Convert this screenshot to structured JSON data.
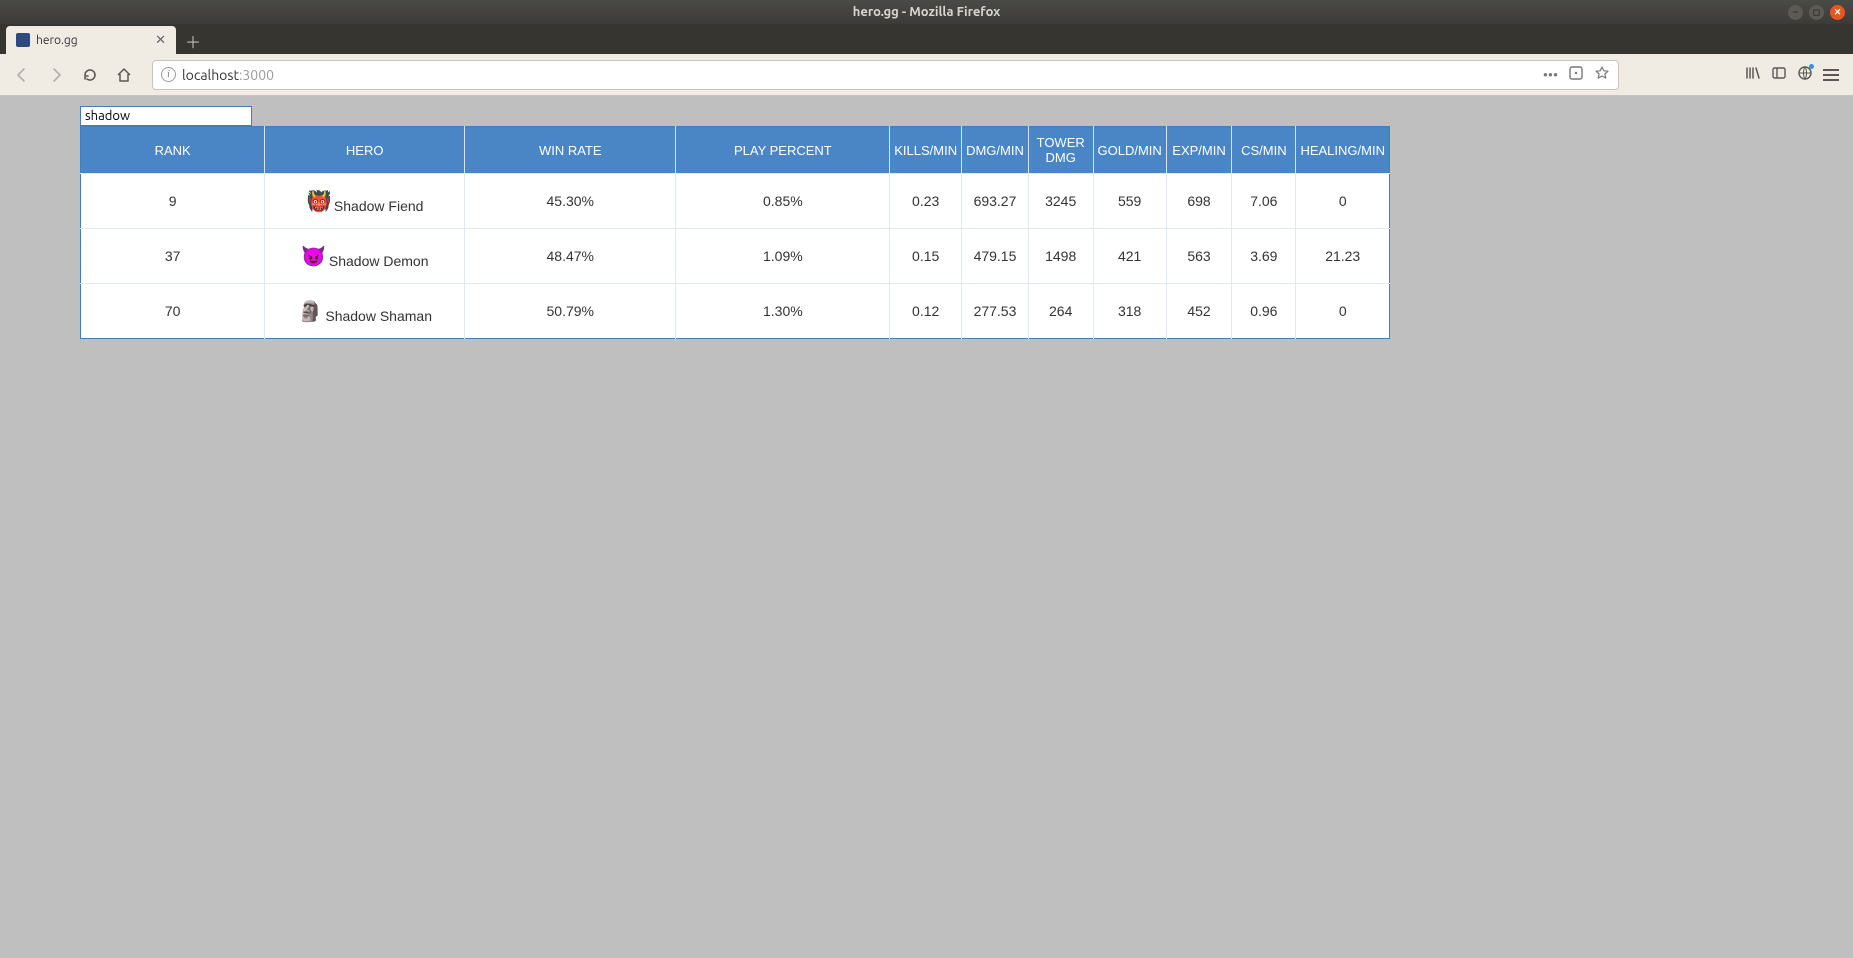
{
  "window": {
    "title": "hero.gg - Mozilla Firefox"
  },
  "tab": {
    "title": "hero.gg"
  },
  "url": {
    "host": "localhost",
    "port": ":3000"
  },
  "search": {
    "value": "shadow"
  },
  "columns": {
    "rank": "RANK",
    "hero": "HERO",
    "win_rate": "WIN RATE",
    "play_percent": "PLAY PERCENT",
    "kills_min": "KILLS/MIN",
    "dmg_min": "DMG/MIN",
    "tower_dmg": "TOWER DMG",
    "gold_min": "GOLD/MIN",
    "exp_min": "EXP/MIN",
    "cs_min": "CS/MIN",
    "healing_min": "HEALING/MIN"
  },
  "rows": [
    {
      "rank": "9",
      "hero": "Shadow Fiend",
      "win_rate": "45.30%",
      "play_percent": "0.85%",
      "kills_min": "0.23",
      "dmg_min": "693.27",
      "tower_dmg": "3245",
      "gold_min": "559",
      "exp_min": "698",
      "cs_min": "7.06",
      "healing_min": "0"
    },
    {
      "rank": "37",
      "hero": "Shadow Demon",
      "win_rate": "48.47%",
      "play_percent": "1.09%",
      "kills_min": "0.15",
      "dmg_min": "479.15",
      "tower_dmg": "1498",
      "gold_min": "421",
      "exp_min": "563",
      "cs_min": "3.69",
      "healing_min": "21.23"
    },
    {
      "rank": "70",
      "hero": "Shadow Shaman",
      "win_rate": "50.79%",
      "play_percent": "1.30%",
      "kills_min": "0.12",
      "dmg_min": "277.53",
      "tower_dmg": "264",
      "gold_min": "318",
      "exp_min": "452",
      "cs_min": "0.96",
      "healing_min": "0"
    }
  ],
  "hero_sprites": {
    "Shadow Fiend": "👹",
    "Shadow Demon": "😈",
    "Shadow Shaman": "🗿"
  }
}
